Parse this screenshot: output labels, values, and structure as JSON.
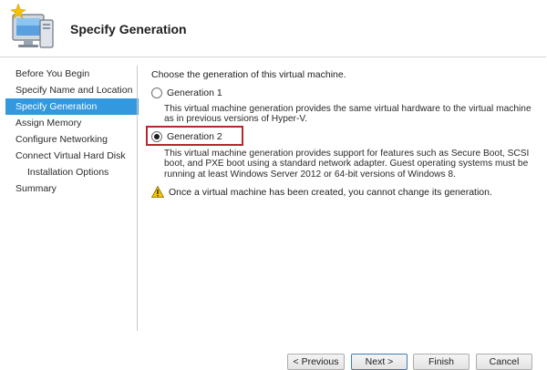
{
  "header": {
    "title": "Specify Generation",
    "icon": "hyper-v-wizard-icon"
  },
  "nav": {
    "items": [
      {
        "label": "Before You Begin",
        "active": false,
        "indent": false
      },
      {
        "label": "Specify Name and Location",
        "active": false,
        "indent": false
      },
      {
        "label": "Specify Generation",
        "active": true,
        "indent": false
      },
      {
        "label": "Assign Memory",
        "active": false,
        "indent": false
      },
      {
        "label": "Configure Networking",
        "active": false,
        "indent": false
      },
      {
        "label": "Connect Virtual Hard Disk",
        "active": false,
        "indent": false
      },
      {
        "label": "Installation Options",
        "active": false,
        "indent": true
      },
      {
        "label": "Summary",
        "active": false,
        "indent": false
      }
    ]
  },
  "content": {
    "intro": "Choose the generation of this virtual machine.",
    "options": [
      {
        "label": "Generation 1",
        "checked": false,
        "description": "This virtual machine generation provides the same virtual hardware to the virtual machine as in previous versions of Hyper-V."
      },
      {
        "label": "Generation 2",
        "checked": true,
        "description": "This virtual machine generation provides support for features such as Secure Boot, SCSI boot, and PXE boot using a standard network adapter. Guest operating systems must be running at least Windows Server 2012 or 64-bit versions of Windows 8."
      }
    ],
    "warning": "Once a virtual machine has been created, you cannot change its generation."
  },
  "buttons": {
    "previous": "< Previous",
    "next": "Next >",
    "finish": "Finish",
    "cancel": "Cancel"
  },
  "colors": {
    "nav_active_bg": "#3398dd",
    "highlight_border": "#b3292e",
    "warning_yellow": "#f7c400"
  }
}
